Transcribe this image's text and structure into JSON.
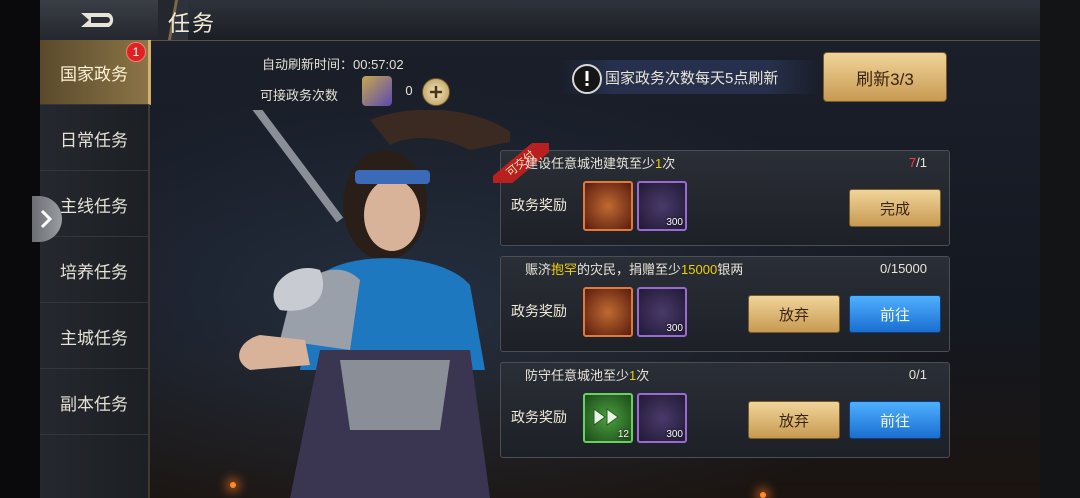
{
  "header": {
    "title": "任务"
  },
  "sidebar": {
    "badge": "1",
    "items": [
      {
        "label": "国家政务"
      },
      {
        "label": "日常任务"
      },
      {
        "label": "主线任务"
      },
      {
        "label": "培养任务"
      },
      {
        "label": "主城任务"
      },
      {
        "label": "副本任务"
      }
    ]
  },
  "top": {
    "auto_refresh": "自动刷新时间：00:57:02",
    "accept_label": "可接政务次数",
    "accept_count": "0",
    "notice": "国家政务次数每天5点刷新",
    "refresh_button": "刷新3/3"
  },
  "tasks": [
    {
      "ribbon": "可交付",
      "title_pre": "建设任意城池建筑至少",
      "title_hl": "1",
      "title_post": "次",
      "progress_current": "7",
      "progress_total": "/1",
      "reward_label": "政务奖励",
      "items": [
        {
          "qty": ""
        },
        {
          "qty": "300"
        }
      ],
      "complete_button": "完成"
    },
    {
      "title_pre": "赈济",
      "title_hl": "抱罕",
      "title_mid": "的灾民，捐赠至少",
      "title_hl2": "15000",
      "title_post": "银两",
      "progress": "0/15000",
      "reward_label": "政务奖励",
      "items": [
        {
          "qty": ""
        },
        {
          "qty": "300"
        }
      ],
      "abandon_button": "放弃",
      "go_button": "前往"
    },
    {
      "title_pre": "防守任意城池至少",
      "title_hl": "1",
      "title_post": "次",
      "progress": "0/1",
      "reward_label": "政务奖励",
      "items": [
        {
          "qty": "12"
        },
        {
          "qty": "300"
        }
      ],
      "abandon_button": "放弃",
      "go_button": "前往"
    }
  ]
}
